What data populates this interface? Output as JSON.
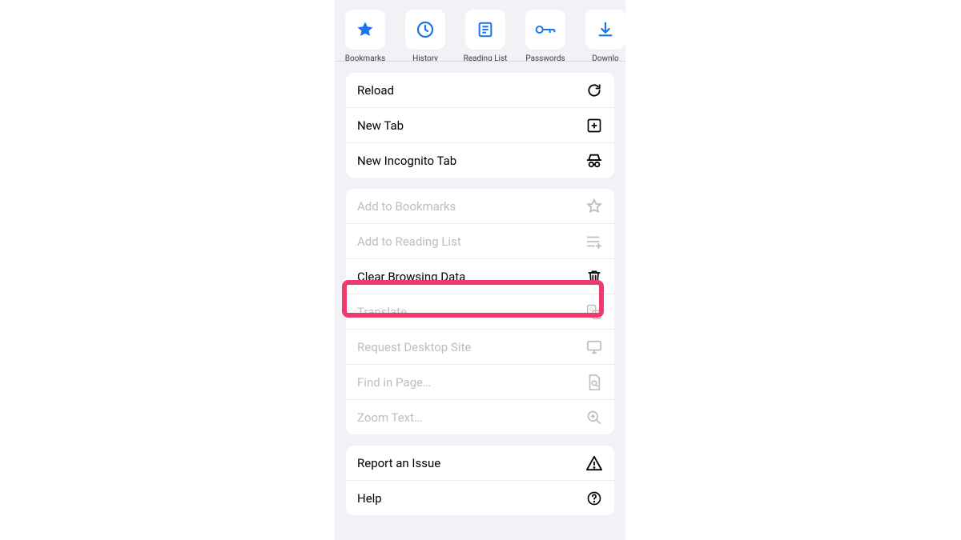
{
  "shortcuts": [
    {
      "label": "Bookmarks",
      "icon": "star-filled-icon"
    },
    {
      "label": "History",
      "icon": "clock-icon"
    },
    {
      "label": "Reading List",
      "icon": "reading-list-icon"
    },
    {
      "label": "Passwords",
      "icon": "key-icon"
    },
    {
      "label": "Downlo",
      "icon": "download-icon"
    }
  ],
  "group1": {
    "reload": "Reload",
    "newtab": "New Tab",
    "incog": "New Incognito Tab"
  },
  "group2": {
    "addbm": "Add to Bookmarks",
    "addrl": "Add to Reading List",
    "clear": "Clear Browsing Data",
    "translate": "Translate",
    "desktop": "Request Desktop Site",
    "find": "Find in Page…",
    "zoom": "Zoom Text…"
  },
  "group3": {
    "report": "Report an Issue",
    "help": "Help"
  },
  "colors": {
    "accent": "#1a73e8",
    "highlight": "#ef3a6d"
  }
}
